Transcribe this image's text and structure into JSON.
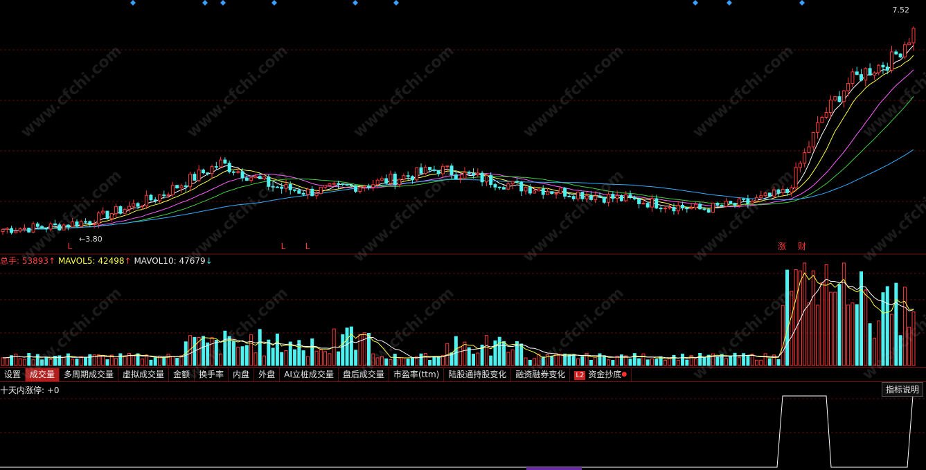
{
  "price_labels": {
    "high": "7.52",
    "low": "3.80"
  },
  "markers": [
    {
      "text": "L"
    },
    {
      "text": "L"
    },
    {
      "text": "L"
    },
    {
      "text": "涨"
    },
    {
      "text": "财"
    }
  ],
  "volume_legend": {
    "total_label": "总手: ",
    "total_value": "53893",
    "total_arrow": "↑",
    "mavol5_label": "MAVOL5: ",
    "mavol5_value": "42498",
    "mavol5_arrow": "↑",
    "mavol10_label": "MAVOL10: ",
    "mavol10_value": "47679",
    "mavol10_arrow": "↓"
  },
  "tabs": [
    {
      "label": "设置",
      "active": false
    },
    {
      "label": "成交量",
      "active": true
    },
    {
      "label": "多周期成交量",
      "active": false
    },
    {
      "label": "虚拟成交量",
      "active": false
    },
    {
      "label": "金额",
      "active": false
    },
    {
      "label": "换手率",
      "active": false
    },
    {
      "label": "内盘",
      "active": false
    },
    {
      "label": "外盘",
      "active": false
    },
    {
      "label": "AI立桩成交量",
      "active": false
    },
    {
      "label": "盘后成交量",
      "active": false
    },
    {
      "label": "市盈率(ttm)",
      "active": false
    },
    {
      "label": "陆股通持股变化",
      "active": false
    },
    {
      "label": "融资融券变化",
      "active": false
    },
    {
      "label": "资金抄底",
      "active": false,
      "badge": "L2"
    }
  ],
  "indicator": {
    "title": "十天内涨停: +0",
    "help_label": "指标说明"
  },
  "watermark": "www.cfchi.com",
  "colors": {
    "up": "#ff3a3a",
    "down": "#4ef0f0",
    "grid": "#5a0e0e",
    "ma5": "#ffffff",
    "ma10": "#ffff40",
    "ma20": "#ff60ff",
    "ma30": "#40d040",
    "ma60": "#30b0ff"
  },
  "chart_data": {
    "type": "candlestick",
    "price_range": [
      3.6,
      7.7
    ],
    "highlight_prices": {
      "max": 7.52,
      "min": 3.8
    },
    "key_closes": [
      3.85,
      3.9,
      4.0,
      4.4,
      5.0,
      4.6,
      4.5,
      4.65,
      4.9,
      4.6,
      4.4,
      4.2,
      4.3,
      4.5,
      5.8,
      6.4,
      6.6,
      6.8,
      7.3
    ],
    "volume_series": [
      "总手",
      "MAVOL5",
      "MAVOL10"
    ],
    "indicator_series": [
      "十天内涨停"
    ],
    "indicator_values": [
      0,
      1,
      0,
      1
    ]
  }
}
